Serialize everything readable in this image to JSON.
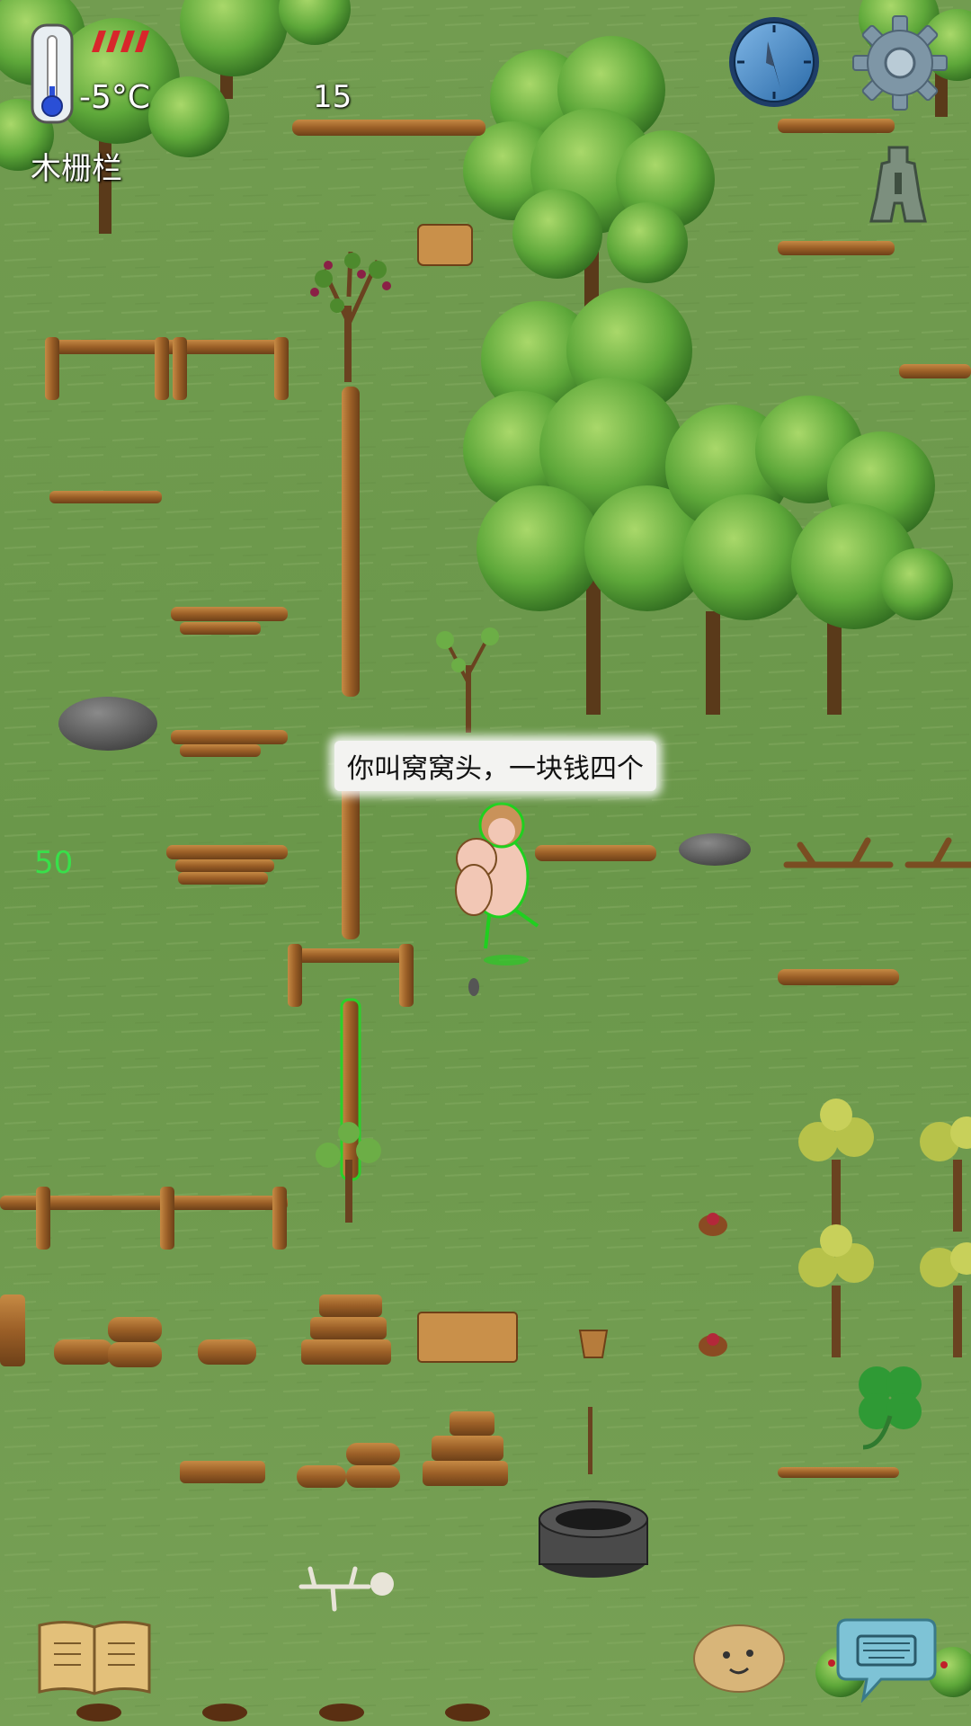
{
  "hud": {
    "temperature": "-5°C",
    "held_item": "木栅栏",
    "counter": "15",
    "age": "50",
    "food_pips": 4
  },
  "speech": {
    "text": "你叫窝窝头，一块钱四个"
  },
  "icons": {
    "thermometer": "thermometer-icon",
    "compass": "compass-icon",
    "settings": "gear-icon",
    "tech_tree": "spade-coin-icon",
    "recipe_book": "book-icon",
    "emote": "potato-face-icon",
    "keyboard": "keyboard-chat-icon",
    "clover": "four-leaf-clover-icon"
  },
  "colors": {
    "grass": "#6f9a4f",
    "food_pip": "#d8262b",
    "age_text": "#38e04a",
    "highlight": "#2bd02b",
    "wood": "#a06a30",
    "leaf": "#5ea83a"
  }
}
